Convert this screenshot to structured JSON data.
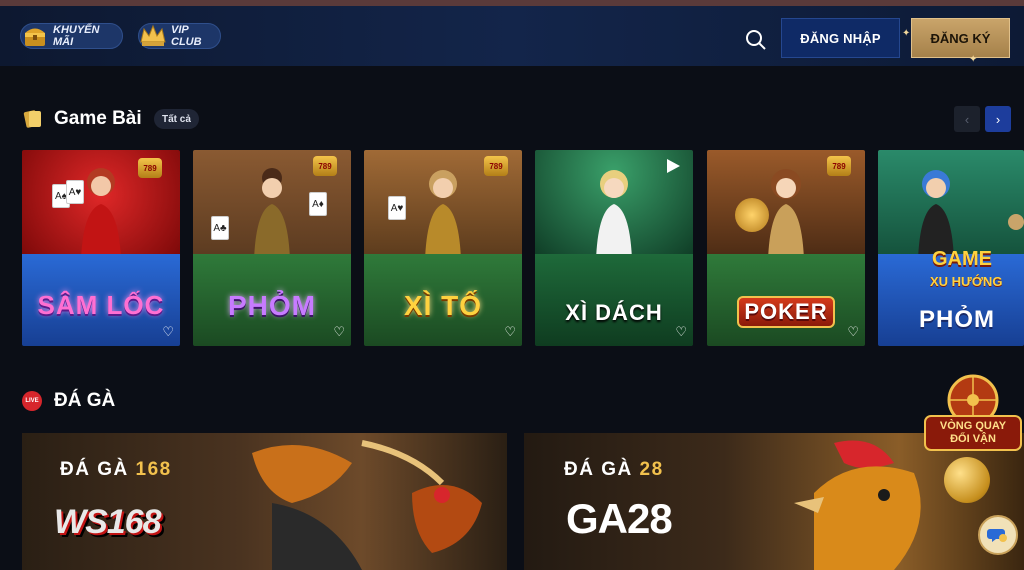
{
  "header": {
    "promo_label": "KHUYẾN MÃI",
    "vip_label": "VIP CLUB",
    "login_label": "ĐĂNG NHẬP",
    "register_label": "ĐĂNG KÝ"
  },
  "game_bai": {
    "title": "Game Bài",
    "all_label": "Tất cả",
    "cards": [
      {
        "title": "SÂM LỐC"
      },
      {
        "title": "PHỎM"
      },
      {
        "title": "XÌ TỐ"
      },
      {
        "title": "XÌ DÁCH"
      },
      {
        "title": "POKER"
      },
      {
        "title": "PHỎM",
        "badge_top": "GAME",
        "badge_sub": "XU HƯỚNG"
      }
    ]
  },
  "da_ga": {
    "live_label": "LIVE",
    "title": "ĐÁ GÀ",
    "banners": [
      {
        "title_word": "ĐÁ GÀ",
        "title_num": "168",
        "brand": "WS168"
      },
      {
        "title_word": "ĐÁ GÀ",
        "title_num": "28",
        "brand": "GA28"
      }
    ]
  },
  "floating": {
    "wheel_line1": "VÒNG QUAY",
    "wheel_line2": "ĐỔI VẬN"
  },
  "colors": {
    "accent_blue": "#1d3d9c",
    "gold": "#c9a46a",
    "bg": "#0b0e16"
  }
}
